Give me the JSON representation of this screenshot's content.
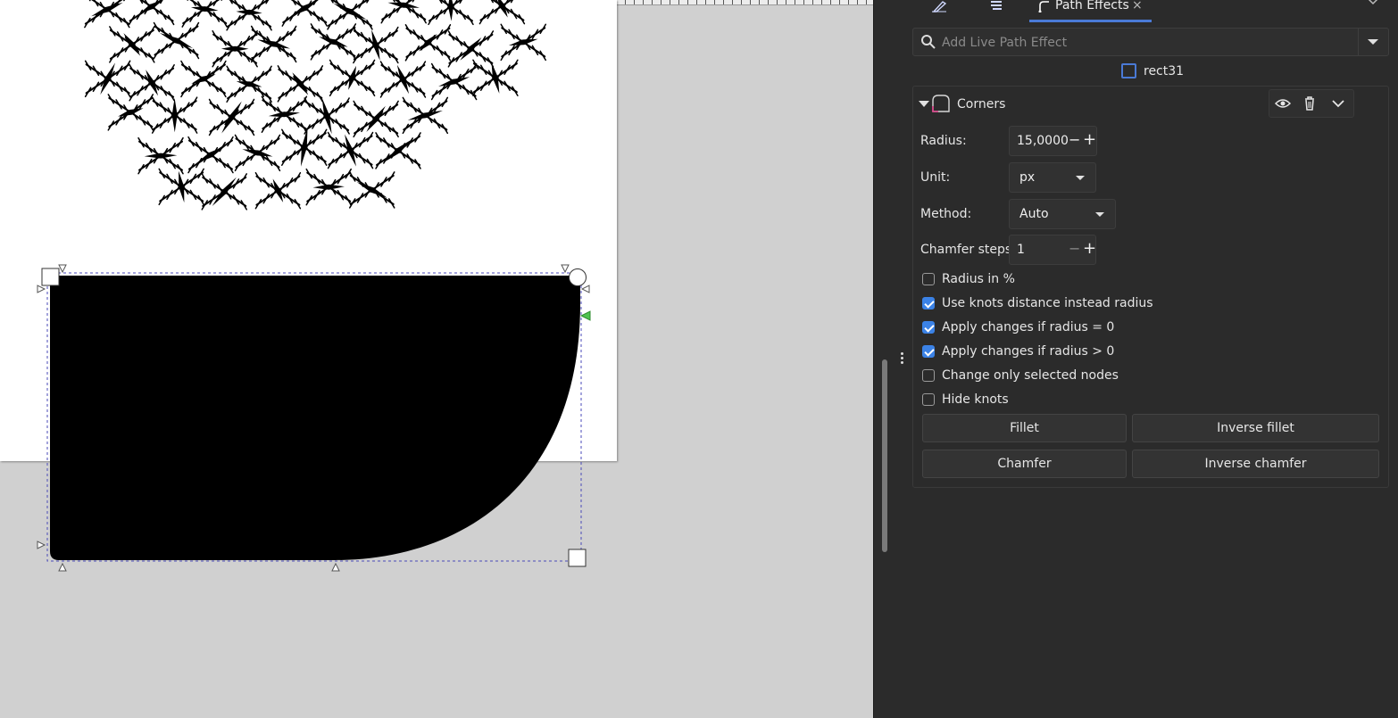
{
  "tabs": {
    "icons": [
      "pen-tool-icon",
      "layers-icon"
    ],
    "active_tab_label": "Path Effects",
    "active_tab_close": "×"
  },
  "search": {
    "placeholder": "Add Live Path Effect"
  },
  "object": {
    "name": "rect31"
  },
  "effect": {
    "name": "Corners",
    "radius_label": "Radius:",
    "radius_value": "15,0000",
    "unit_label": "Unit:",
    "unit_value": "px",
    "method_label": "Method:",
    "method_value": "Auto",
    "chamfer_label": "Chamfer steps:",
    "chamfer_value": "1",
    "checkboxes": [
      {
        "label": "Radius in %",
        "checked": false
      },
      {
        "label": "Use knots distance instead radius",
        "checked": true
      },
      {
        "label": "Apply changes if radius = 0",
        "checked": true
      },
      {
        "label": "Apply changes if radius > 0",
        "checked": true
      },
      {
        "label": "Change only selected nodes",
        "checked": false
      },
      {
        "label": "Hide knots",
        "checked": false
      }
    ],
    "buttons": {
      "fillet": "Fillet",
      "inverse_fillet": "Inverse fillet",
      "chamfer": "Chamfer",
      "inverse_chamfer": "Inverse chamfer"
    }
  },
  "colors": {
    "accent": "#4a7ad6",
    "checkbox_on": "#3b82e6",
    "panel_bg": "#2b2b2b",
    "canvas_bg": "#d0d0d0"
  }
}
